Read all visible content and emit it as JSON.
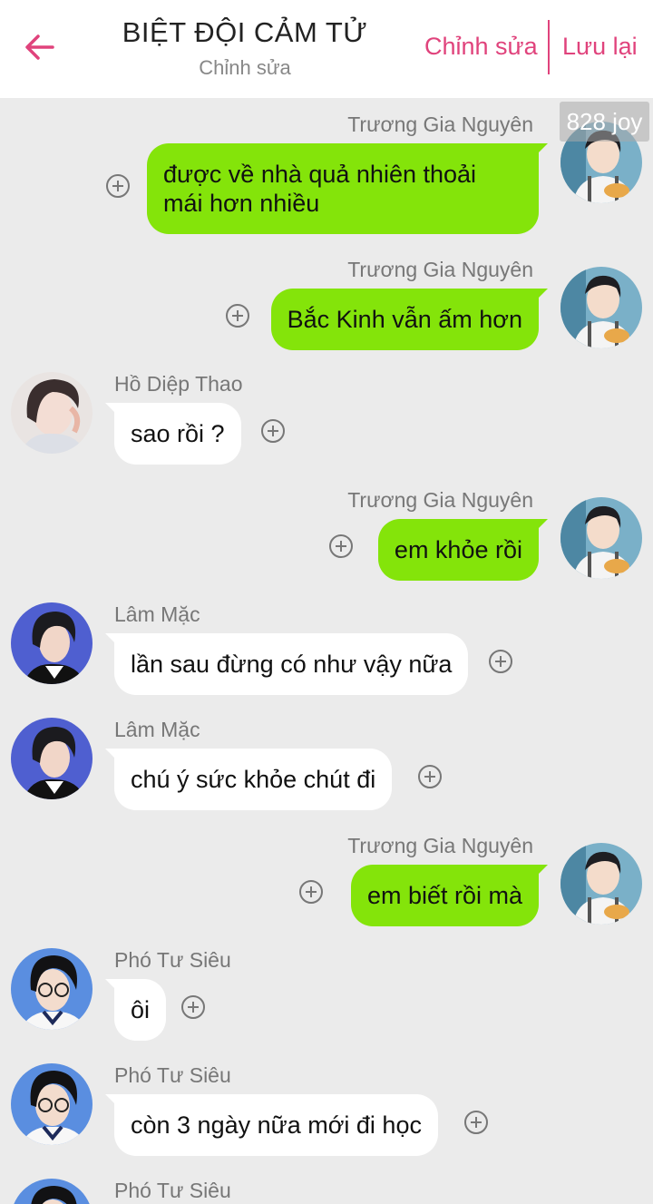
{
  "header": {
    "title": "BIỆT ĐỘI CẢM TỬ",
    "subtitle": "Chỉnh sửa",
    "edit_label": "Chỉnh sửa",
    "save_label": "Lưu lại",
    "accent_color": "#e0437c"
  },
  "watermark": "828 joy",
  "colors": {
    "outgoing_bubble": "#84e40a",
    "incoming_bubble": "#ffffff",
    "background": "#ebebeb"
  },
  "messages": [
    {
      "side": "out",
      "sender": "Trương Gia Nguyên",
      "text": "được về nhà quả nhiên thoải\nmái hơn nhiều"
    },
    {
      "side": "out",
      "sender": "Trương Gia Nguyên",
      "text": "Bắc Kinh vẫn ấm hơn"
    },
    {
      "side": "in",
      "sender": "Hồ Diệp Thao",
      "text": "sao rồi ?"
    },
    {
      "side": "out",
      "sender": "Trương Gia Nguyên",
      "text": "em khỏe rồi"
    },
    {
      "side": "in",
      "sender": "Lâm Mặc",
      "text": "lần sau đừng có như vậy nữa"
    },
    {
      "side": "in",
      "sender": "Lâm Mặc",
      "text": "chú ý sức khỏe chút đi"
    },
    {
      "side": "out",
      "sender": "Trương Gia Nguyên",
      "text": "em biết rồi mà"
    },
    {
      "side": "in",
      "sender": "Phó Tư Siêu",
      "text": "ôi"
    },
    {
      "side": "in",
      "sender": "Phó Tư Siêu",
      "text": "còn 3 ngày nữa mới đi học"
    },
    {
      "side": "in",
      "sender": "Phó Tư Siêu",
      "text": ""
    }
  ]
}
